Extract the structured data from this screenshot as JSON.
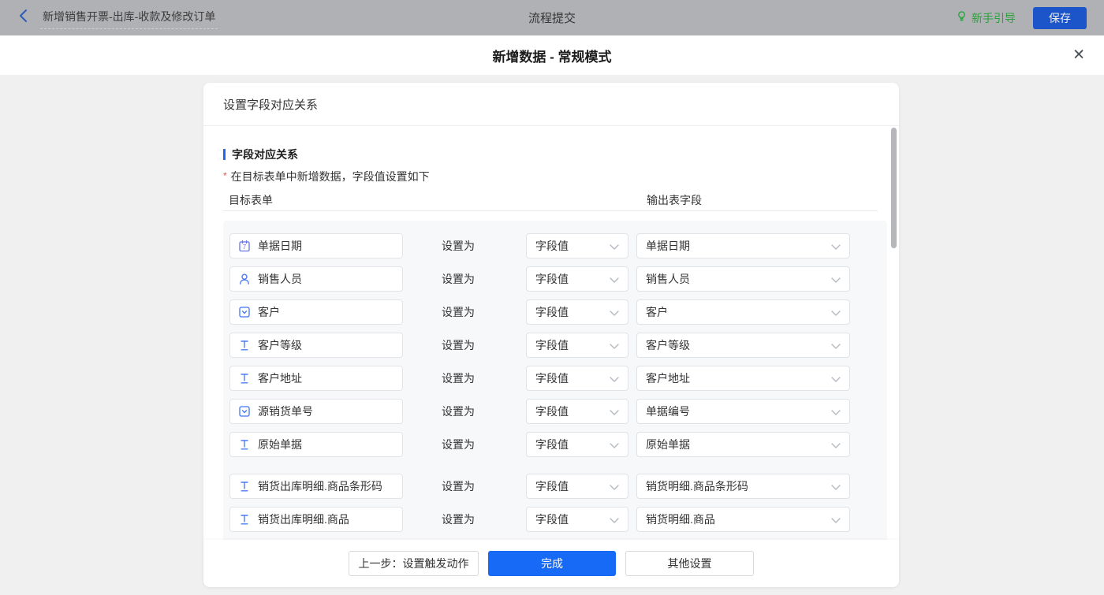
{
  "topbar": {
    "title": "新增销售开票-出库-收款及修改订单",
    "center_label": "流程提交",
    "guide_label": "新手引导",
    "save_label": "保存"
  },
  "modal": {
    "title": "新增数据 - 常规模式",
    "close_glyph": "✕"
  },
  "card": {
    "header": "设置字段对应关系",
    "section_title": "字段对应关系",
    "required_mark": "*",
    "description": "在目标表单中新增数据，字段值设置如下",
    "col_target": "目标表单",
    "col_output": "输出表字段",
    "set_as": "设置为",
    "rows": [
      {
        "icon": "calendar-icon",
        "field": "单据日期",
        "method": "字段值",
        "output": "单据日期"
      },
      {
        "icon": "user-icon",
        "field": "销售人员",
        "method": "字段值",
        "output": "销售人员"
      },
      {
        "icon": "select-icon",
        "field": "客户",
        "method": "字段值",
        "output": "客户"
      },
      {
        "icon": "text-icon",
        "field": "客户等级",
        "method": "字段值",
        "output": "客户等级"
      },
      {
        "icon": "text-icon",
        "field": "客户地址",
        "method": "字段值",
        "output": "客户地址"
      },
      {
        "icon": "select-icon",
        "field": "源销货单号",
        "method": "字段值",
        "output": "单据编号"
      },
      {
        "icon": "text-icon",
        "field": "原始单据",
        "method": "字段值",
        "output": "原始单据"
      },
      {
        "icon": "text-icon",
        "field": "销货出库明细.商品条形码",
        "method": "字段值",
        "output": "销货明细.商品条形码",
        "gap_before": true
      },
      {
        "icon": "text-icon",
        "field": "销货出库明细.商品",
        "method": "字段值",
        "output": "销货明细.商品"
      }
    ],
    "footer": {
      "prev": "上一步：设置触发动作",
      "done": "完成",
      "other": "其他设置"
    }
  },
  "colors": {
    "accent_blue": "#2468f2",
    "done_button_blue": "#176af6",
    "field_icon_blue": "#4d7cf3",
    "calendar_icon_blue": "#6674e8",
    "guide_green": "#2aa13e",
    "required_red": "#e25050",
    "dimmed_save_blue": "#1c55c9",
    "topbar_dimmed_gray": "#b0b1b4"
  }
}
